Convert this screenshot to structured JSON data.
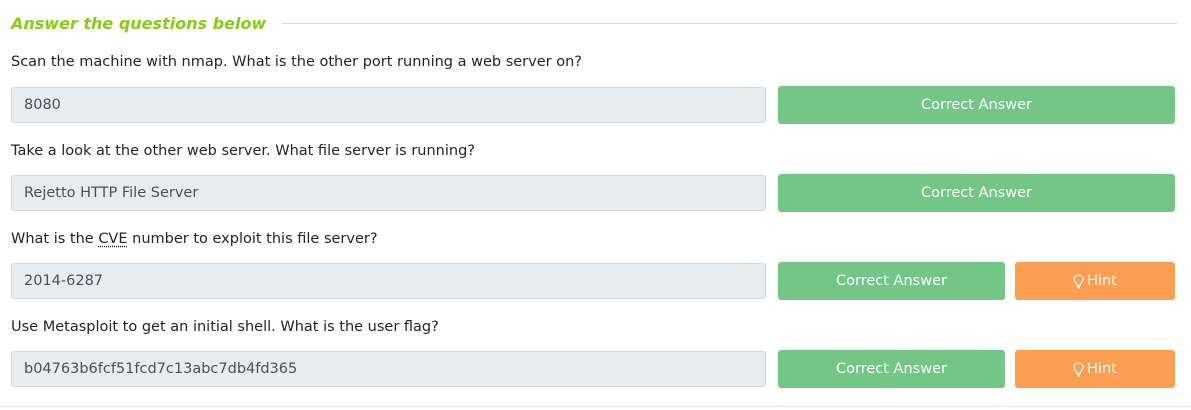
{
  "header": {
    "title": "Answer the questions below"
  },
  "questions": [
    {
      "text": "Scan the machine with nmap. What is the other port running a web server on?",
      "answer": "8080",
      "correct_label": "Correct Answer"
    },
    {
      "text": "Take a look at the other web server. What file server is running?",
      "answer": "Rejetto HTTP File Server",
      "correct_label": "Correct Answer"
    },
    {
      "text_before": "What is the ",
      "text_abbr": "CVE",
      "text_after": " number to exploit this file server?",
      "answer": "2014-6287",
      "correct_label": "Correct Answer",
      "hint_label": "Hint"
    },
    {
      "text": "Use Metasploit to get an initial shell. What is the user flag?",
      "answer": "b04763b6fcf51fcd7c13abc7db4fd365",
      "correct_label": "Correct Answer",
      "hint_label": "Hint"
    }
  ],
  "colors": {
    "accent_green": "#88cc14",
    "correct_button": "#73c685",
    "hint_button": "#fd9f53",
    "answer_field_bg": "#e9ecef"
  }
}
